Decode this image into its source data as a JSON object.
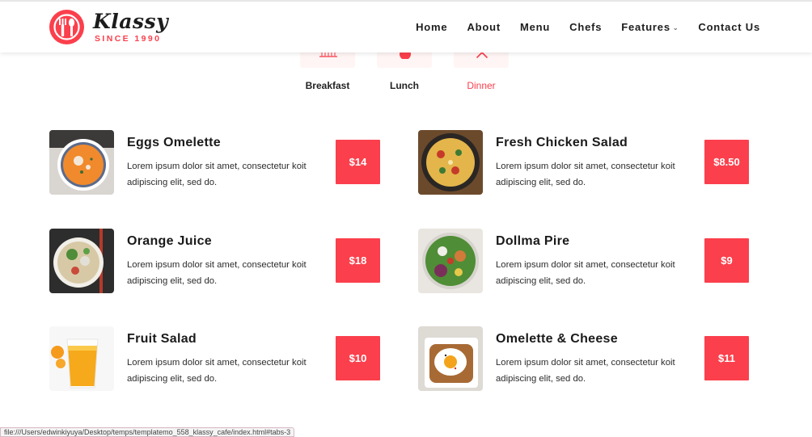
{
  "brand": {
    "name": "Klassy",
    "tagline": "SINCE 1990",
    "accent_color": "#fb3f4c"
  },
  "nav": {
    "items": [
      {
        "label": "Home"
      },
      {
        "label": "About"
      },
      {
        "label": "Menu"
      },
      {
        "label": "Chefs"
      },
      {
        "label": "Features",
        "icon": "chevron-down-icon"
      },
      {
        "label": "Contact Us"
      }
    ]
  },
  "tabs": [
    {
      "label": "Breakfast",
      "icon": "breakfast-icon",
      "active": false
    },
    {
      "label": "Lunch",
      "icon": "lunch-icon",
      "active": false
    },
    {
      "label": "Dinner",
      "icon": "dinner-icon",
      "active": true
    }
  ],
  "menu": {
    "items": [
      {
        "title": "Eggs Omelette",
        "description": "Lorem ipsum dolor sit amet, consectetur koit adipiscing elit, sed do.",
        "price": "$14",
        "image": "pumpkin-soup-image"
      },
      {
        "title": "Fresh Chicken Salad",
        "description": "Lorem ipsum dolor sit amet, consectetur koit adipiscing elit, sed do.",
        "price": "$8.50",
        "image": "skillet-pasta-image"
      },
      {
        "title": "Orange Juice",
        "description": "Lorem ipsum dolor sit amet, consectetur koit adipiscing elit, sed do.",
        "price": "$18",
        "image": "noodle-bowl-image"
      },
      {
        "title": "Dollma Pire",
        "description": "Lorem ipsum dolor sit amet, consectetur koit adipiscing elit, sed do.",
        "price": "$9",
        "image": "salad-bowl-image"
      },
      {
        "title": "Fruit Salad",
        "description": "Lorem ipsum dolor sit amet, consectetur koit adipiscing elit, sed do.",
        "price": "$10",
        "image": "orange-juice-image"
      },
      {
        "title": "Omelette & Cheese",
        "description": "Lorem ipsum dolor sit amet, consectetur koit adipiscing elit, sed do.",
        "price": "$11",
        "image": "egg-toast-image"
      }
    ]
  },
  "status_bar": {
    "url": "file:///Users/edwinkiyuya/Desktop/temps/templatemo_558_klassy_cafe/index.html#tabs-3"
  }
}
